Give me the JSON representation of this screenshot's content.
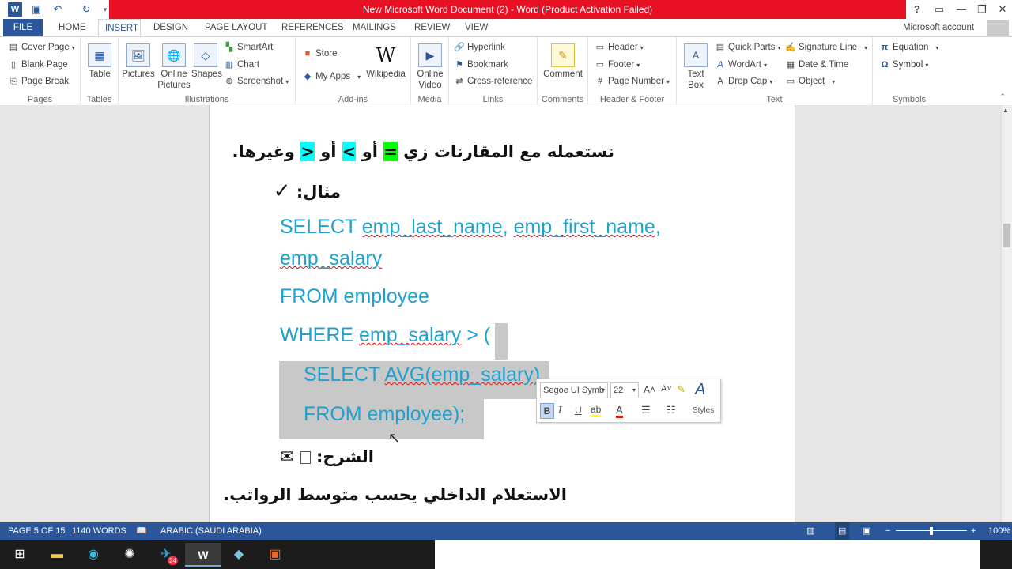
{
  "window": {
    "title": "New Microsoft Word Document (2) - Word (Product Activation Failed)",
    "help": "?"
  },
  "tabs": [
    "FILE",
    "HOME",
    "INSERT",
    "DESIGN",
    "PAGE LAYOUT",
    "REFERENCES",
    "MAILINGS",
    "REVIEW",
    "VIEW"
  ],
  "account": "Microsoft account",
  "ribbon": {
    "pages": {
      "label": "Pages",
      "items": [
        "Cover Page",
        "Blank Page",
        "Page Break"
      ]
    },
    "tables": {
      "label": "Tables",
      "table": "Table"
    },
    "illustrations": {
      "label": "Illustrations",
      "pictures": "Pictures",
      "online_pictures": "Online Pictures",
      "shapes": "Shapes",
      "smartart": "SmartArt",
      "chart": "Chart",
      "screenshot": "Screenshot"
    },
    "addins": {
      "label": "Add-ins",
      "store": "Store",
      "my_apps": "My Apps",
      "wikipedia": "Wikipedia"
    },
    "media": {
      "label": "Media",
      "online_video": "Online Video"
    },
    "links": {
      "label": "Links",
      "hyperlink": "Hyperlink",
      "bookmark": "Bookmark",
      "cross_reference": "Cross-reference"
    },
    "comments": {
      "label": "Comments",
      "comment": "Comment"
    },
    "header_footer": {
      "label": "Header & Footer",
      "header": "Header",
      "footer": "Footer",
      "page_number": "Page Number"
    },
    "text": {
      "label": "Text",
      "text_box": "Text Box",
      "quick_parts": "Quick Parts",
      "wordart": "WordArt",
      "drop_cap": "Drop Cap",
      "signature_line": "Signature Line",
      "date_time": "Date & Time",
      "object": "Object"
    },
    "symbols": {
      "label": "Symbols",
      "equation": "Equation",
      "symbol": "Symbol"
    }
  },
  "document": {
    "line1_pre": "نستعمله مع المقارنات زي ",
    "line1_eq": "=",
    "line1_or1": " أو ",
    "line1_gt": ">",
    "line1_or2": " أو ",
    "line1_lt": "<",
    "line1_post": " وغيرها.",
    "example": "مثال:",
    "check": "✓",
    "code": {
      "select": "SELECT",
      "col1": "emp_last_name",
      "comma1": ",",
      "col2": "emp_first_name",
      "comma2": ",",
      "col3": "emp_salary",
      "from": "FROM employee",
      "where": "WHERE",
      "where_col": "emp_salary",
      "where_op": "> (",
      "sub_select": "SELECT",
      "sub_func": "AVG(emp_salary)",
      "sub_from": "FROM employee);"
    },
    "explain_label": "الشرح:",
    "explain_text": "الاستعلام الداخلي يحسب متوسط الرواتب."
  },
  "minitoolbar": {
    "font": "Segoe UI Symb",
    "size": "22",
    "bold": "B",
    "italic": "I",
    "underline": "U",
    "styles": "Styles"
  },
  "status": {
    "page": "PAGE 5 OF 15",
    "words": "1140 WORDS",
    "language": "ARABIC (SAUDI ARABIA)",
    "zoom": "100%"
  },
  "taskbar": {
    "telegram_badge": "24"
  }
}
